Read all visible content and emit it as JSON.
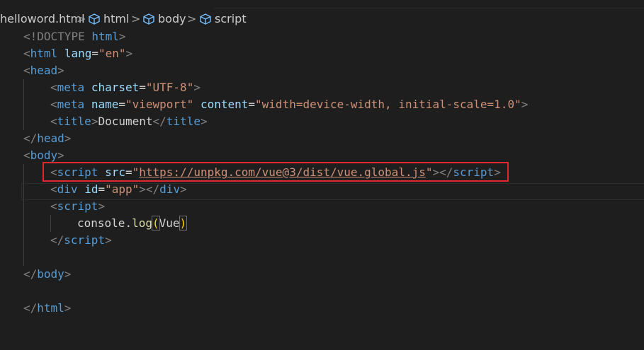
{
  "breadcrumb": {
    "items": [
      "helloword.html",
      "html",
      "body",
      "script"
    ],
    "separator": ">"
  },
  "icons": {
    "element": "cube-icon",
    "chevron": "chevron-right-icon"
  },
  "colors": {
    "background": "#1e1e1e",
    "tag": "#569cd6",
    "bracket": "#808080",
    "attribute": "#9cdcfe",
    "string": "#ce9178",
    "function": "#dcdcaa",
    "paren": "#ffd700",
    "highlight": "#e0282e"
  },
  "code": {
    "doctype_kw": "!DOCTYPE",
    "doctype_val": "html",
    "tag_html": "html",
    "attr_lang": "lang",
    "val_lang": "\"en\"",
    "tag_head": "head",
    "tag_meta": "meta",
    "attr_charset": "charset",
    "val_charset": "\"UTF-8\"",
    "attr_name": "name",
    "val_name": "\"viewport\"",
    "attr_content": "content",
    "val_content": "\"width=device-width, initial-scale=1.0\"",
    "tag_title": "title",
    "title_text": "Document",
    "tag_body": "body",
    "tag_script": "script",
    "attr_src": "src",
    "quote": "\"",
    "val_src": "https://unpkg.com/vue@3/dist/vue.global.js",
    "tag_div": "div",
    "attr_id": "id",
    "val_id": "\"app\"",
    "console": "console",
    "log": "log",
    "arg": "Vue"
  }
}
